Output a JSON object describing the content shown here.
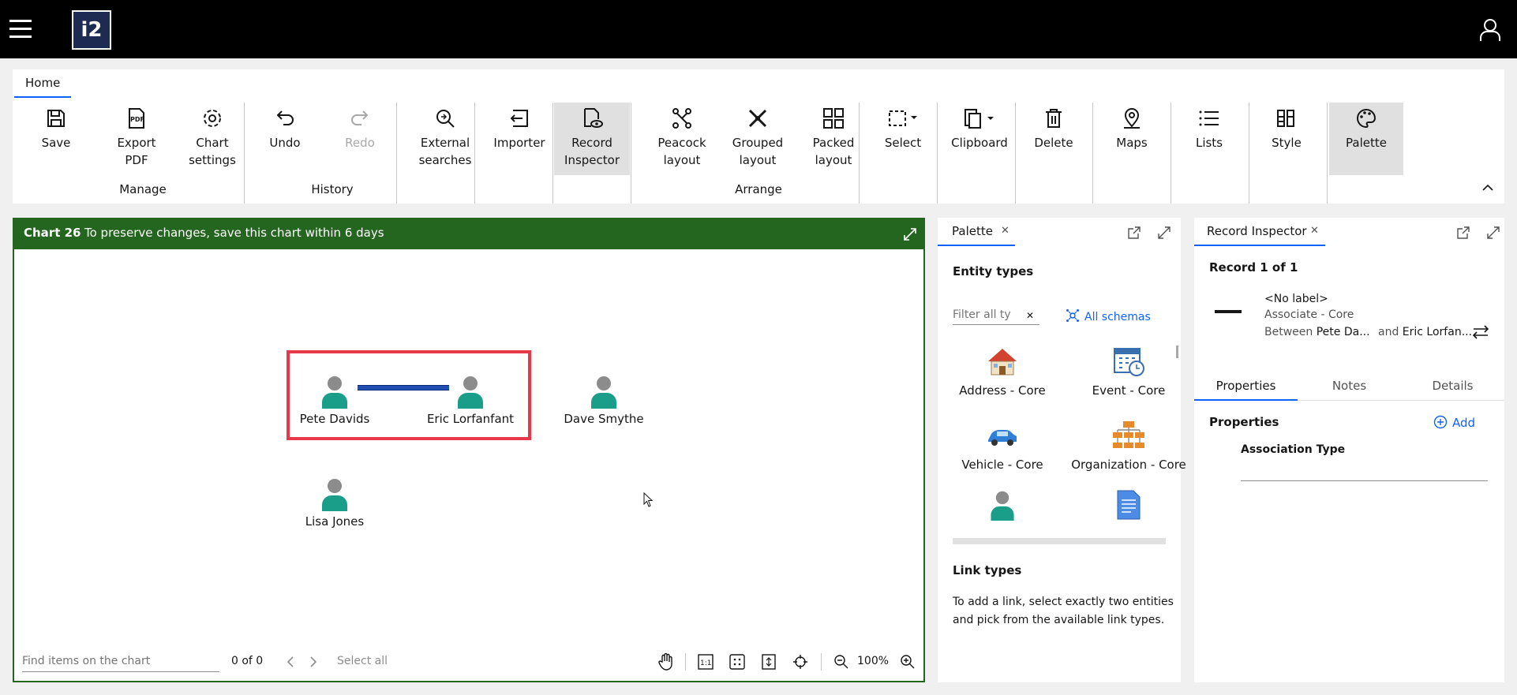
{
  "app": {
    "logo_text": "i2"
  },
  "ribbon": {
    "tab": "Home",
    "buttons": {
      "save": "Save",
      "export_pdf": [
        "Export",
        "PDF"
      ],
      "chart_settings": [
        "Chart",
        "settings"
      ],
      "undo": "Undo",
      "redo": "Redo",
      "external_searches": [
        "External",
        "searches"
      ],
      "importer": "Importer",
      "record_inspector": [
        "Record",
        "Inspector"
      ],
      "peacock_layout": [
        "Peacock",
        "layout"
      ],
      "grouped_layout": [
        "Grouped",
        "layout"
      ],
      "packed_layout": [
        "Packed",
        "layout"
      ],
      "select": "Select",
      "clipboard": "Clipboard",
      "delete": "Delete",
      "maps": "Maps",
      "lists": "Lists",
      "style": "Style",
      "palette": "Palette"
    },
    "groups": {
      "manage": "Manage",
      "history": "History",
      "arrange": "Arrange"
    }
  },
  "chart": {
    "title": "Chart 26",
    "message": "To preserve changes, save this chart within 6 days",
    "nodes": [
      {
        "label": "Pete Davids"
      },
      {
        "label": "Eric Lorfanfant"
      },
      {
        "label": "Dave Smythe"
      },
      {
        "label": "Lisa Jones"
      }
    ],
    "footer": {
      "find_placeholder": "Find items on the chart",
      "count": "0 of 0",
      "select_all": "Select all",
      "zoom": "100%"
    }
  },
  "palette": {
    "tab": "Palette",
    "entity_types_title": "Entity types",
    "filter_placeholder": "Filter all ty",
    "all_schemas": "All schemas",
    "items": [
      "Address - Core",
      "Event - Core",
      "Vehicle - Core",
      "Organization - Core"
    ],
    "link_types_title": "Link types",
    "link_types_help": [
      "To add a link, select exactly two entities",
      "and pick from the available link types."
    ]
  },
  "inspector": {
    "tab": "Record Inspector",
    "record_count": "Record 1 of 1",
    "record_label": "<No label>",
    "record_type": "Associate - Core",
    "between_word": "Between",
    "between_a": "Pete Da...",
    "and_word": "and",
    "between_b": "Eric Lorfan...",
    "subtabs": [
      "Properties",
      "Notes",
      "Details"
    ],
    "properties_title": "Properties",
    "add_label": "Add",
    "property_name": "Association Type"
  },
  "colors": {
    "chart_header": "#24661f",
    "accent": "#0f62fe",
    "selection": "#e8394a",
    "link": "#1f4fb0"
  }
}
